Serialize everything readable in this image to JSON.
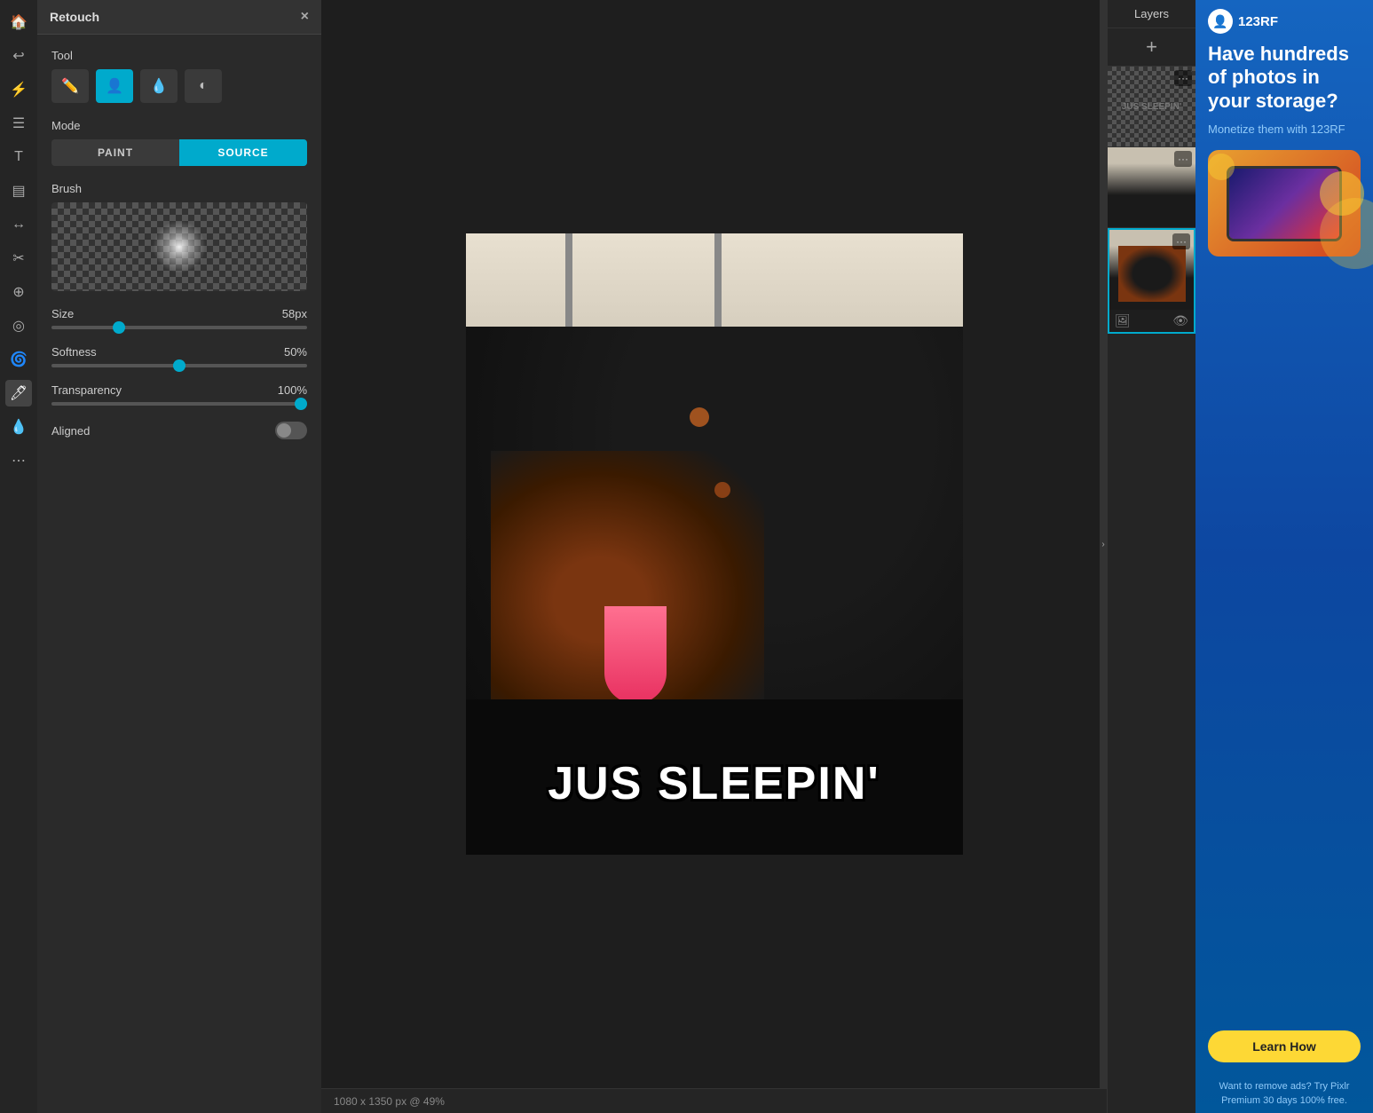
{
  "retouch": {
    "title": "Retouch",
    "close_label": "×",
    "tool_label": "Tool",
    "mode_label": "Mode",
    "brush_label": "Brush",
    "size_label": "Size",
    "size_value": "58px",
    "softness_label": "Softness",
    "softness_value": "50%",
    "transparency_label": "Transparency",
    "transparency_value": "100%",
    "aligned_label": "Aligned",
    "mode_paint": "PAINT",
    "mode_source": "SOURCE",
    "size_percent": 25,
    "softness_percent": 50,
    "transparency_percent": 100
  },
  "layers": {
    "title": "Layers",
    "add_label": "+"
  },
  "canvas": {
    "meme_text": "JUS SLEEPIN'",
    "status_text": "1080 x 1350 px @ 49%"
  },
  "ad": {
    "logo_icon": "👤",
    "logo_name": "123RF",
    "headline": "Have hundreds of photos in your storage?",
    "subheadline": "Monetize them with 123RF",
    "learn_how": "Learn How",
    "remove_text": "Want to remove ads? Try Pixlr Premium 30 days 100% free."
  },
  "left_toolbar": {
    "icons": [
      "🏠",
      "↩",
      "⚡",
      "☰",
      "T",
      "▤",
      "↔",
      "✂",
      "⚙",
      "◎",
      "🌀",
      "🖊",
      "🔵",
      "⋯"
    ]
  }
}
